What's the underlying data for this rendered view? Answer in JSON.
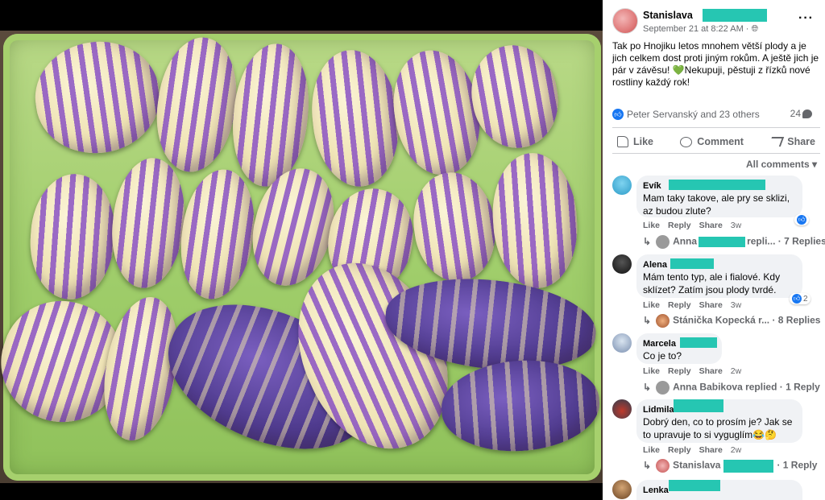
{
  "post": {
    "author": "Stanislava",
    "timestamp": "September 21 at 8:22 AM · ",
    "privacy_icon": "globe-icon",
    "more": "···",
    "text_part1": "Tak po Hnojiku letos mnohem větší plody a je jich celkem dost proti jiným rokům. A ještě jich je pár v závěsu! ",
    "heart": "💚",
    "text_part2": "Nekupuji, pěstuji z řízků nové rostliny každý rok!",
    "reactions_text": "Peter Servanský and 23 others",
    "comment_count": "24",
    "like_label": "Like",
    "comment_label": "Comment",
    "share_label": "Share",
    "all_comments": "All comments ▾"
  },
  "comments": [
    {
      "name": "Evík",
      "text": "Mam taky takove, ale pry se sklizi, az budou zlute?",
      "like": "Like",
      "reply": "Reply",
      "share": "Share",
      "time": "3w",
      "replies": "Anna",
      "replies_suffix": "repli... · 7 Replies"
    },
    {
      "name": "Alena",
      "text": "Mám tento typ, ale i fialové. Kdy sklízet? Zatím jsou plody tvrdé.",
      "like": "Like",
      "reply": "Reply",
      "share": "Share",
      "time": "3w",
      "react_count": "2",
      "replies": "Stánička Kopecká r...",
      "replies_suffix": " · 8 Replies"
    },
    {
      "name": "Marcela",
      "text": "Co je to?",
      "like": "Like",
      "reply": "Reply",
      "share": "Share",
      "time": "2w",
      "replies": "Anna Babikova replied",
      "replies_suffix": " · 1 Reply"
    },
    {
      "name": "Lidmila",
      "text": "Dobrý den, co to prosím je? Jak se to upravuje to si vyguglím😂🤔",
      "like": "Like",
      "reply": "Reply",
      "share": "Share",
      "time": "2w",
      "replies": "Stanislava",
      "replies_suffix": "· 1 Reply"
    },
    {
      "name": "Lenka"
    }
  ],
  "colors": {
    "redaction": "#26c6b2",
    "fb_blue": "#1877f2",
    "text_secondary": "#65676b",
    "bubble_bg": "#f0f2f5"
  }
}
